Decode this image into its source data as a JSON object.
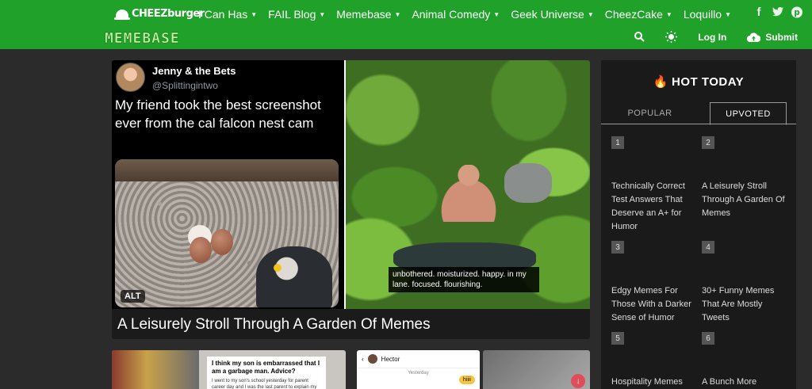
{
  "brand": "CHEEZburger",
  "nav": [
    "I Can Has",
    "FAIL Blog",
    "Memebase",
    "Animal Comedy",
    "Geek Universe",
    "CheezCake",
    "Loquillo"
  ],
  "social_icons": [
    "facebook-icon",
    "twitter-icon",
    "pinterest-icon"
  ],
  "site_logo": "MEMEBASE",
  "actions": {
    "login": "Log In",
    "submit": "Submit"
  },
  "feature": {
    "tweet_name": "Jenny & the Bets",
    "tweet_handle": "@Splittingintwo",
    "tweet_text": "My friend took the best screenshot ever from the cal falcon nest cam",
    "alt_badge": "ALT",
    "caption": "unbothered. moisturized. happy. in my lane. focused. flourishing.",
    "title": "A Leisurely Stroll Through A Garden Of Memes"
  },
  "thumbs": {
    "t1_question": "I think my son is embarrassed that I am a garbage man. Advice?",
    "t1_body": "I went to my son's school yesterday for parent career day and I was the last parent to explain my",
    "t2_name": "Hector",
    "t2_day": "Yesterday",
    "t2_bubble": "hiiii"
  },
  "sidebar": {
    "heading": "HOT TODAY",
    "tabs": {
      "popular": "POPULAR",
      "upvoted": "UPVOTED"
    },
    "items": [
      {
        "rank": "1",
        "title": "Technically Correct Test Answers That Deserve an A+ for Humor"
      },
      {
        "rank": "2",
        "title": "A Leisurely Stroll Through A Garden Of Memes"
      },
      {
        "rank": "3",
        "title": "Edgy Memes For Those With a Darker Sense of Humor"
      },
      {
        "rank": "4",
        "title": "30+ Funny Memes That Are Mostly Tweets"
      },
      {
        "rank": "5",
        "title": "Hospitality Memes"
      },
      {
        "rank": "6",
        "title": "A Bunch More"
      }
    ]
  }
}
